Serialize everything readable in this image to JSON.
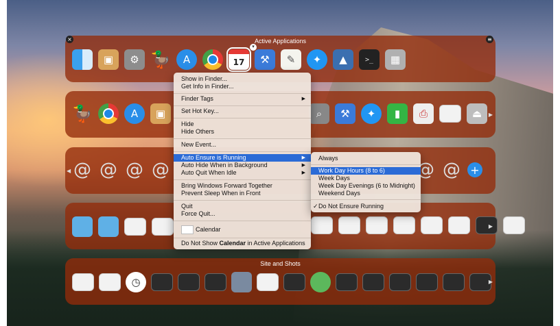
{
  "panels": {
    "active": {
      "title": "Active Applications"
    },
    "shots": {
      "title": "Site and Shots"
    }
  },
  "calendar_day": "17",
  "menu": {
    "items": [
      "Show in Finder...",
      "Get Info in Finder...",
      "Finder Tags",
      "Set Hot Key...",
      "Hide",
      "Hide Others",
      "New Event...",
      "Auto Ensure is Running",
      "Auto Hide When in Background",
      "Auto Quit When Idle",
      "Bring Windows Forward Together",
      "Prevent Sleep When in Front",
      "Quit",
      "Force Quit...",
      "Calendar"
    ],
    "last_prefix": "Do Not Show ",
    "last_bold": "Calendar",
    "last_suffix": " in Active Applications"
  },
  "submenu": {
    "items": [
      "Always",
      "Work Day Hours (8 to 6)",
      "Week Days",
      "Week Day Evenings (6 to Midnight)",
      "Weekend Days",
      "Do Not Ensure Running"
    ],
    "checked_mark": "✓"
  },
  "icons": {
    "row1": [
      "finder-icon",
      "preview-icon",
      "system-preferences-icon",
      "cyberduck-icon",
      "app-store-icon",
      "chrome-icon",
      "calendar-icon",
      "xcode-icon",
      "textedit-icon",
      "safari-icon",
      "preview-photo-icon",
      "terminal-icon",
      "calculator-icon"
    ]
  },
  "colors": {
    "panel": "#942c0a",
    "highlight": "#2b6bd6"
  }
}
